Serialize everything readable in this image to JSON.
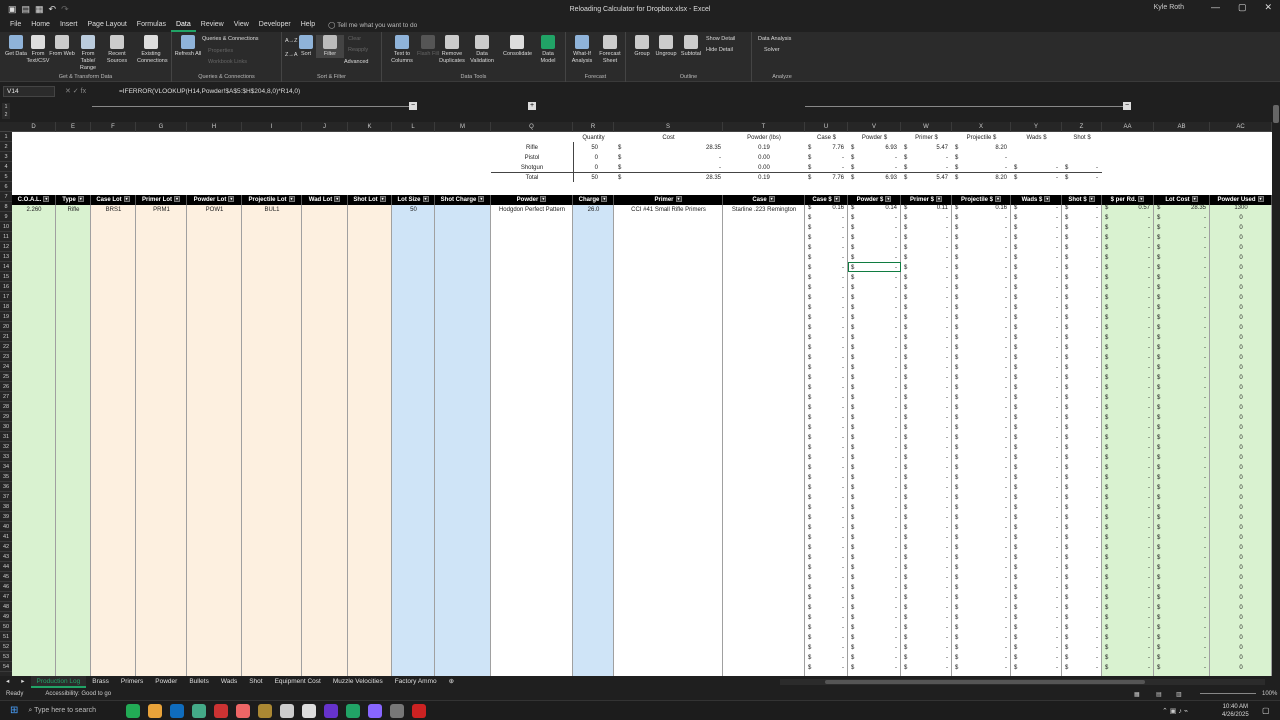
{
  "window": {
    "title": "Reloading Calculator for Dropbox.xlsx - Excel",
    "user": "Kyle Roth"
  },
  "menu": {
    "tabs": [
      "File",
      "Home",
      "Insert",
      "Page Layout",
      "Formulas",
      "Data",
      "Review",
      "View",
      "Developer",
      "Help"
    ],
    "active": "Data",
    "tell_me": "Tell me what you want to do"
  },
  "ribbon": {
    "get_data": "Get Data",
    "from_text": "From Text/CSV",
    "from_web": "From Web",
    "from_table": "From Table/ Range",
    "recent_sources": "Recent Sources",
    "existing_connections": "Existing Connections",
    "group1": "Get & Transform Data",
    "refresh_all": "Refresh All",
    "queries": "Queries & Connections",
    "properties": "Properties",
    "edit_links": "Workbook Links",
    "group2": "Queries & Connections",
    "sort_az": "A→Z",
    "sort_za": "Z→A",
    "sort": "Sort",
    "filter": "Filter",
    "clear": "Clear",
    "reapply": "Reapply",
    "advanced": "Advanced",
    "group3": "Sort & Filter",
    "text_to_columns": "Text to Columns",
    "flash_fill": "Flash Fill",
    "remove_duplicates": "Remove Duplicates",
    "data_validation": "Data Validation",
    "consolidate": "Consolidate",
    "data_model": "Data Model",
    "group4": "Data Tools",
    "what_if": "What-If Analysis",
    "forecast_sheet": "Forecast Sheet",
    "group5": "Forecast",
    "group_btn": "Group",
    "ungroup": "Ungroup",
    "subtotal": "Subtotal",
    "show_detail": "Show Detail",
    "hide_detail": "Hide Detail",
    "group6": "Outline",
    "data_analysis": "Data Analysis",
    "solver": "Solver",
    "group7": "Analyze"
  },
  "formula_bar": {
    "cell": "V14",
    "formula": "=IFERROR(VLOOKUP(H14,Powder!$A$5:$H$204,8,0)*R14,0)"
  },
  "columns": [
    "D",
    "E",
    "F",
    "G",
    "H",
    "I",
    "J",
    "K",
    "L",
    "M",
    "Q",
    "R",
    "S",
    "T",
    "U",
    "V",
    "W",
    "X",
    "Y",
    "Z",
    "AA",
    "AB",
    "AC"
  ],
  "summary": {
    "headers": {
      "quantity": "Quantity",
      "cost": "Cost",
      "powder_lbs": "Powder (lbs)",
      "case": "Case $",
      "powder": "Powder $",
      "primer": "Primer $",
      "projectile": "Projectile $",
      "wads": "Wads $",
      "shot": "Shot $"
    },
    "rows": [
      {
        "label": "Rifle",
        "qty": "50",
        "cost": "28.35",
        "lbs": "0.19",
        "case": "7.76",
        "powder": "6.93",
        "primer": "5.47",
        "proj": "8.20",
        "wads": "",
        "shot": ""
      },
      {
        "label": "Pistol",
        "qty": "0",
        "cost": "-",
        "lbs": "0.00",
        "case": "-",
        "powder": "-",
        "primer": "-",
        "proj": "-",
        "wads": "",
        "shot": ""
      },
      {
        "label": "Shotgun",
        "qty": "0",
        "cost": "-",
        "lbs": "0.00",
        "case": "-",
        "powder": "-",
        "primer": "-",
        "proj": "-",
        "wads": "-",
        "shot": "-"
      },
      {
        "label": "Total",
        "qty": "50",
        "cost": "28.35",
        "lbs": "0.19",
        "case": "7.76",
        "powder": "6.93",
        "primer": "5.47",
        "proj": "8.20",
        "wads": "-",
        "shot": "-"
      }
    ]
  },
  "table": {
    "headers": [
      "C.O.A.L.",
      "Type",
      "Case Lot",
      "Primer Lot",
      "Powder Lot",
      "Projectile Lot",
      "Wad Lot",
      "Shot Lot",
      "Lot Size",
      "Shot Charge",
      "Powder",
      "Charge",
      "Primer",
      "Case",
      "Case $",
      "Powder $",
      "Primer $",
      "Projectile $",
      "Wads $",
      "Shot $",
      "$ per Rd.",
      "Lot Cost",
      "Powder Used"
    ],
    "row8": {
      "coal": "2.260",
      "type": "Rifle",
      "case_lot": "BRS1",
      "primer_lot": "PRM1",
      "powder_lot": "POW1",
      "proj_lot": "BUL1",
      "lot_size": "50",
      "powder": "Hodgdon Perfect Pattern",
      "charge": "26.0",
      "primer": "CCI #41 Small Rifle Primers",
      "case": "Starline .223 Remington",
      "case_c": "0.16",
      "powder_c": "0.14",
      "primer_c": "0.11",
      "proj_c": "0.16",
      "per_rd": "0.57",
      "lot_cost": "28.35",
      "powder_used": "1300"
    },
    "dollar": "$",
    "dash": "-",
    "zero": "0"
  },
  "sheets": [
    "Production Log",
    "Brass",
    "Primers",
    "Powder",
    "Bullets",
    "Wads",
    "Shot",
    "Equipment Cost",
    "Muzzle Velocities",
    "Factory Ammo"
  ],
  "active_sheet": "Production Log",
  "status": {
    "ready": "Ready",
    "accessibility": "Accessibility: Good to go",
    "zoom": "100%"
  },
  "taskbar": {
    "search": "Type here to search",
    "time": "10:40 AM",
    "date": "4/26/2025"
  },
  "colors": {
    "green": "#d9f2d0",
    "peach": "#fdf0e0",
    "blue": "#cfe4f7",
    "excel": "#21a366"
  }
}
